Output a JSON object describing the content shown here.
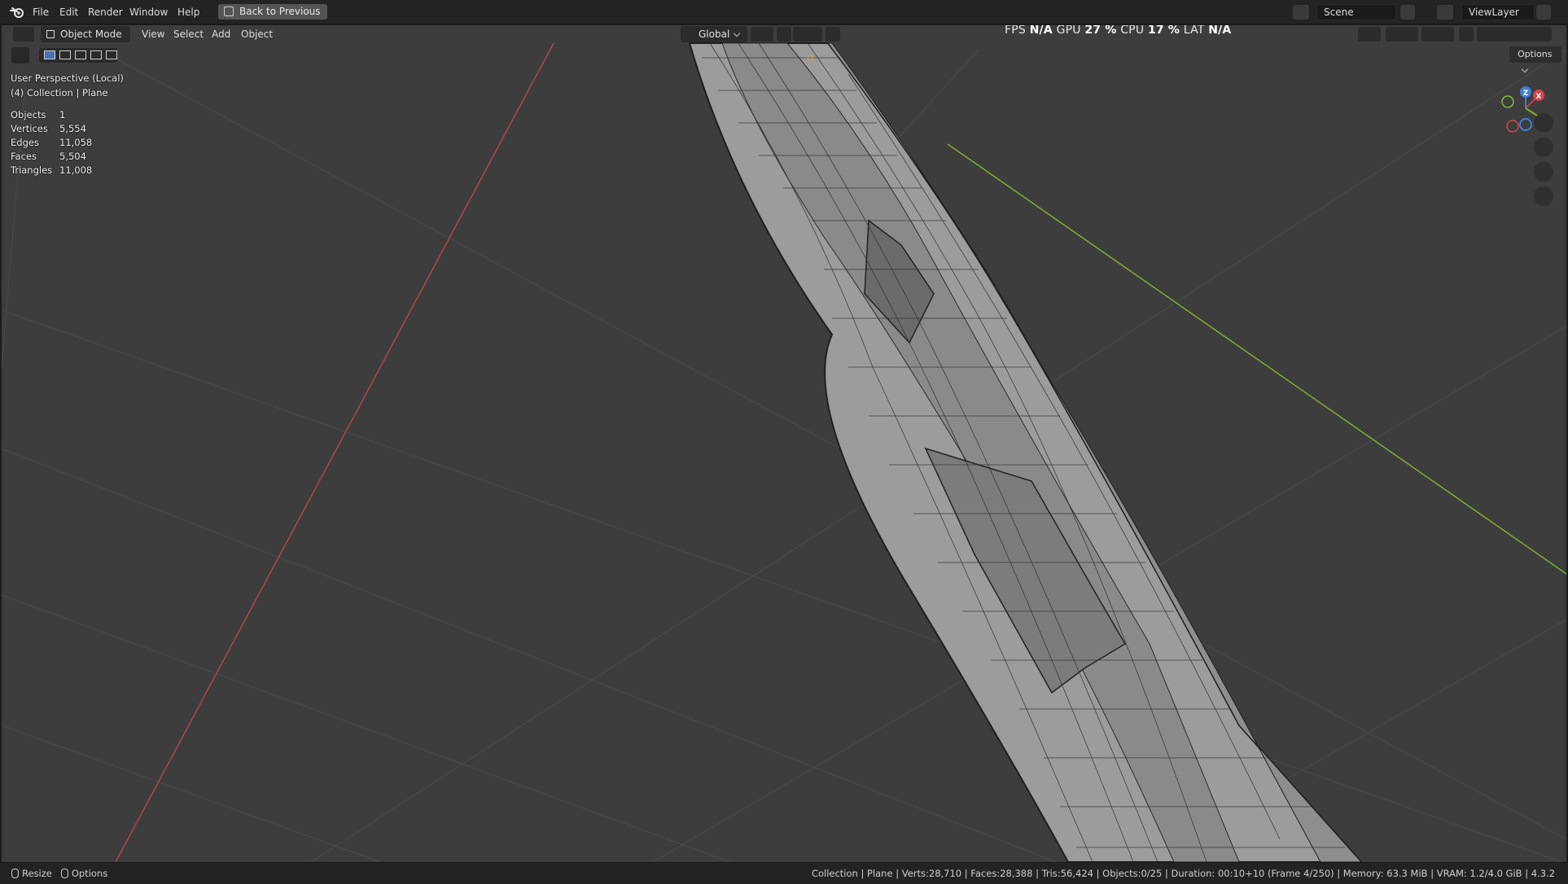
{
  "topbar": {
    "menu": [
      "File",
      "Edit",
      "Render",
      "Window",
      "Help"
    ],
    "back_button": "Back to Previous",
    "scene": "Scene",
    "view_layer": "ViewLayer"
  },
  "viewport_header": {
    "mode": "Object Mode",
    "menus": [
      "View",
      "Select",
      "Add",
      "Object"
    ],
    "transform_orientation": "Global",
    "options": "Options",
    "perf": {
      "fps_label": "FPS",
      "fps_value": "N/A",
      "gpu_label": "GPU",
      "gpu_value": "27 %",
      "cpu_label": "CPU",
      "cpu_value": "17 %",
      "lat_label": "LAT",
      "lat_value": "N/A"
    }
  },
  "overlay": {
    "view_name": "User Perspective (Local)",
    "collection": "(4) Collection | Plane",
    "stats": [
      {
        "label": "Objects",
        "value": "1"
      },
      {
        "label": "Vertices",
        "value": "5,554"
      },
      {
        "label": "Edges",
        "value": "11,058"
      },
      {
        "label": "Faces",
        "value": "5,504"
      },
      {
        "label": "Triangles",
        "value": "11,008"
      }
    ]
  },
  "gizmo": {
    "x": "X",
    "y": "Y",
    "z": "Z"
  },
  "colors": {
    "viewport_bg": "#3d3d3d",
    "x_axis": "#b8434a",
    "y_axis": "#7fae2e",
    "mesh_fill": "#9a9a9a",
    "wire": "#2a2a2a"
  },
  "statusbar": {
    "resize": "Resize",
    "options": "Options",
    "info": "Collection | Plane | Verts:28,710 | Faces:28,388 | Tris:56,424 | Objects:0/25 | Duration: 00:10+10 (Frame 4/250) | Memory: 63.3 MiB | VRAM: 1.2/4.0 GiB | 4.3.2"
  }
}
